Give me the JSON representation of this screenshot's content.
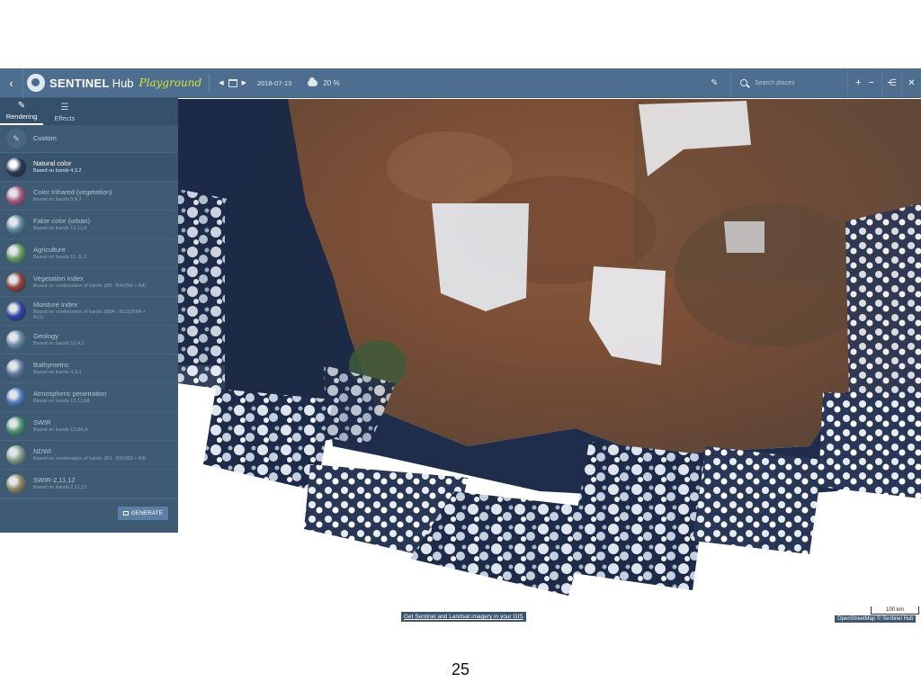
{
  "topbar": {
    "brand": "SENTINEL",
    "brand_suffix": "Hub",
    "playground": "Playground",
    "date": "2018-07-13",
    "cloud_coverage": "20 %",
    "search_placeholder": "Search places",
    "zoom_in": "+",
    "zoom_out": "−"
  },
  "sidebar": {
    "tabs": [
      {
        "label": "Rendering",
        "icon": "brush-icon",
        "active": true
      },
      {
        "label": "Effects",
        "icon": "sliders-icon",
        "active": false
      }
    ],
    "custom_label": "Custom",
    "items": [
      {
        "title": "Natural color",
        "subtitle": "Based on bands 4,3,2",
        "thumb_color": "#2a3a52",
        "active": true
      },
      {
        "title": "Color Infrared (vegetation)",
        "subtitle": "Based on bands 8,4,3",
        "thumb_color": "#b5567a",
        "active": false
      },
      {
        "title": "False color (urban)",
        "subtitle": "Based on bands 12,11,4",
        "thumb_color": "#5f8fa0",
        "active": false
      },
      {
        "title": "Agriculture",
        "subtitle": "Based on bands 11, 8, 2",
        "thumb_color": "#6aa85a",
        "active": false
      },
      {
        "title": "Vegetation Index",
        "subtitle": "Based on combination of bands (B8 - B4)/(B8 + B4)",
        "thumb_color": "#a23a2e",
        "active": false
      },
      {
        "title": "Moisture Index",
        "subtitle": "Based on combination of bands (B8A - B11)/(B8A + B11)",
        "thumb_color": "#2d3fa8",
        "active": false
      },
      {
        "title": "Geology",
        "subtitle": "Based on bands 12,4,2",
        "thumb_color": "#6d8faa",
        "active": false
      },
      {
        "title": "Bathymetric",
        "subtitle": "Based on bands 4,3,1",
        "thumb_color": "#6a7fa8",
        "active": false
      },
      {
        "title": "Atmospheric penetration",
        "subtitle": "Based on bands 12,11,8A",
        "thumb_color": "#4f7cc2",
        "active": false
      },
      {
        "title": "SWIR",
        "subtitle": "Based on bands 12,8A,4",
        "thumb_color": "#4e9a70",
        "active": false
      },
      {
        "title": "NDWI",
        "subtitle": "Based on combination of bands (B3 - B8)/(B3 + B8)",
        "thumb_color": "#8da68e",
        "active": false
      },
      {
        "title": "SWIR-2,11,12",
        "subtitle": "Based on bands 2,11,12",
        "thumb_color": "#9b8a5a",
        "active": false
      }
    ],
    "generate_label": "GENERATE"
  },
  "map": {
    "gis_link": "Get Sentinel and Landsat imagery in your GIS",
    "scale_label": "100 km",
    "attribution": "OpenStreetMap © Sentinel Hub"
  },
  "page_number": "25"
}
